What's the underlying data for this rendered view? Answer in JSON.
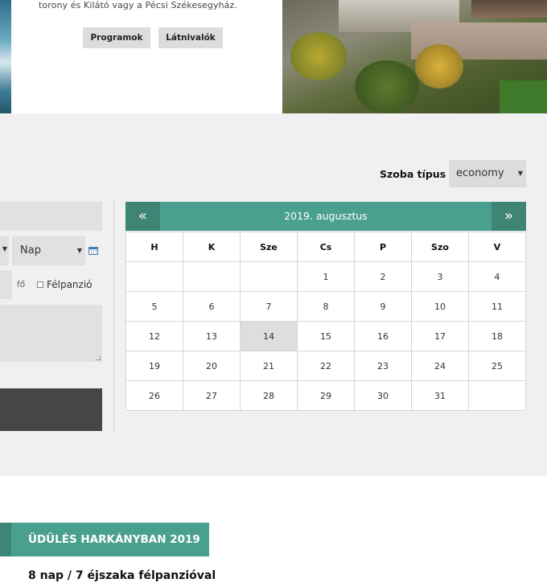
{
  "hero": {
    "description": "torony és Kilátó vagy a Pécsi Székesegyház.",
    "buttons": {
      "programs": "Programok",
      "sights": "Látnivalók"
    }
  },
  "booking": {
    "room_type_label": "Szoba típus",
    "room_type_value": "economy",
    "day_placeholder": "Nap",
    "persons_unit": "fő",
    "halfboard_label": "Félpanzió"
  },
  "calendar": {
    "title": "2019. augusztus",
    "prev_label": "«",
    "next_label": "»",
    "weekdays": [
      "H",
      "K",
      "Sze",
      "Cs",
      "P",
      "Szo",
      "V"
    ],
    "weeks": [
      [
        "",
        "",
        "",
        "1",
        "2",
        "3",
        "4"
      ],
      [
        "5",
        "6",
        "7",
        "8",
        "9",
        "10",
        "11"
      ],
      [
        "12",
        "13",
        "14",
        "15",
        "16",
        "17",
        "18"
      ],
      [
        "19",
        "20",
        "21",
        "22",
        "23",
        "24",
        "25"
      ],
      [
        "26",
        "27",
        "28",
        "29",
        "30",
        "31",
        ""
      ]
    ],
    "highlighted_day": "14"
  },
  "offer": {
    "ribbon_title": "ÜDÜLÉS HARKÁNYBAN 2019",
    "subtitle": "8 nap / 7 éjszaka félpanzióval"
  },
  "colors": {
    "accent": "#4aa08e",
    "accent_dark": "#3f8576",
    "button_grey": "#dcdcdc",
    "submit_dark": "#464646",
    "section_bg": "#f0f0f0"
  }
}
